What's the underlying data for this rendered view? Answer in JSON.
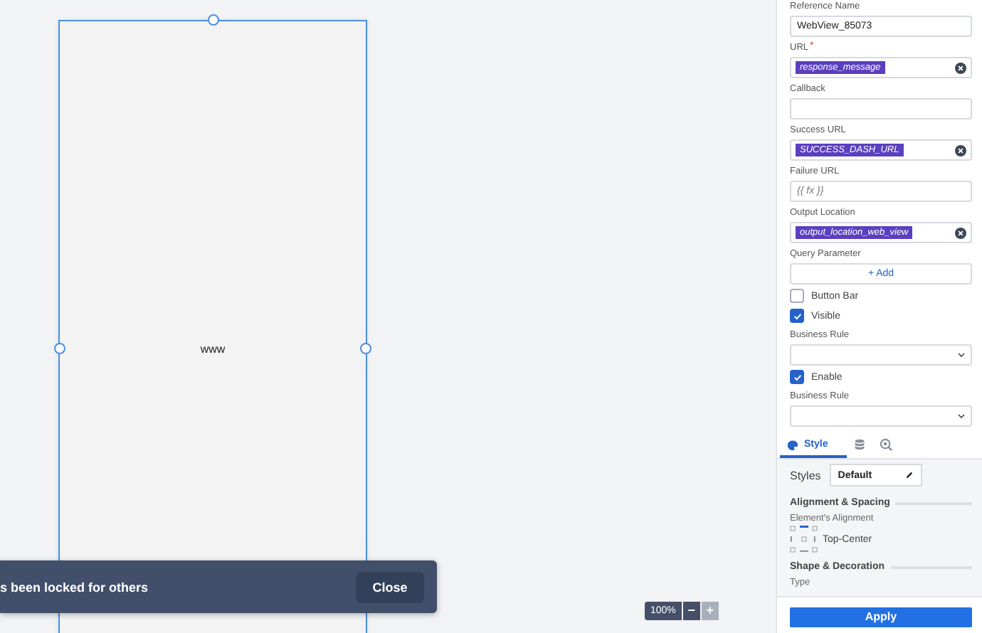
{
  "canvas": {
    "frame_text": "www"
  },
  "toast": {
    "message": "s been locked for others",
    "button": "Close"
  },
  "zoom": {
    "value": "100%",
    "buttons": [
      {
        "label": "−",
        "disabled": false
      },
      {
        "label": "+",
        "disabled": true
      }
    ]
  },
  "properties": [
    {
      "kind": "text",
      "label": "Reference Name",
      "required": false,
      "value": "WebView_85073"
    },
    {
      "kind": "token",
      "label": "URL",
      "required": true,
      "value": "response_message"
    },
    {
      "kind": "text",
      "label": "Callback",
      "required": false
    },
    {
      "kind": "token",
      "label": "Success URL",
      "required": false,
      "value": "SUCCESS_DASH_URL"
    },
    {
      "kind": "text",
      "label": "Failure URL",
      "required": false,
      "placeholder": "{{ fx }}"
    },
    {
      "kind": "token",
      "label": "Output Location",
      "required": false,
      "value": "output_location_web_view"
    },
    {
      "kind": "add",
      "label": "Query Parameter",
      "button": "+ Add"
    },
    {
      "kind": "checkbox",
      "label": "Button Bar",
      "checked": false
    },
    {
      "kind": "checkbox",
      "label": "Visible",
      "checked": true
    },
    {
      "kind": "select",
      "label": "Business Rule"
    },
    {
      "kind": "checkbox",
      "label": "Enable",
      "checked": true
    },
    {
      "kind": "select",
      "label": "Business Rule"
    }
  ],
  "tabs": [
    {
      "kind": "style",
      "label": "Style",
      "selected": true
    },
    {
      "kind": "data",
      "selected": false
    },
    {
      "kind": "inspect",
      "selected": false
    }
  ],
  "style_panel": {
    "styles_label": "Styles",
    "styles_value": "Default",
    "alignment_heading": "Alignment & Spacing",
    "alignment_label": "Element's Alignment",
    "alignment_value": "Top-Center",
    "shape_heading": "Shape & Decoration",
    "type_label": "Type"
  },
  "apply_button": "Apply",
  "required_mark": "*"
}
